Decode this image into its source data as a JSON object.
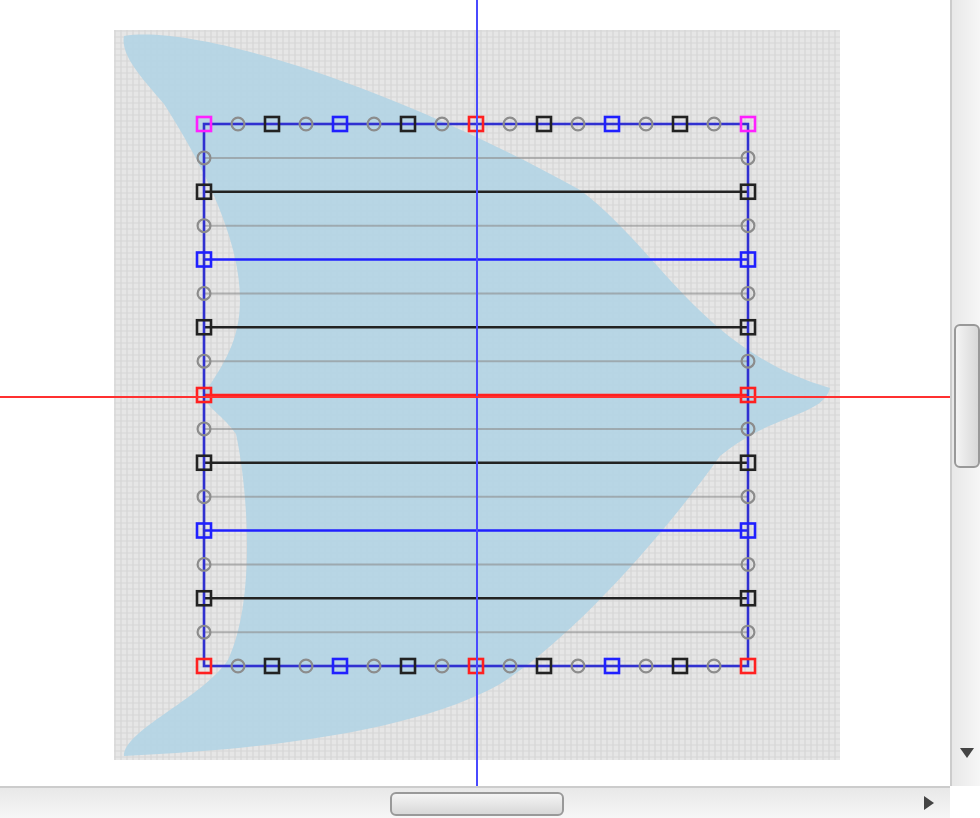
{
  "guides": [
    {
      "kind": "vertical",
      "color": "#4a4aff"
    },
    {
      "kind": "horizontal",
      "color": "#ff3030"
    }
  ],
  "rows": [
    {
      "kind": "circle",
      "color": "#8c8c8c"
    },
    {
      "kind": "square",
      "color": "#222222"
    },
    {
      "kind": "circle",
      "color": "#8c8c8c"
    },
    {
      "kind": "square",
      "color": "#2020ff"
    },
    {
      "kind": "circle",
      "color": "#8c8c8c"
    },
    {
      "kind": "square",
      "color": "#222222"
    },
    {
      "kind": "circle",
      "color": "#8c8c8c"
    },
    {
      "kind": "square",
      "color": "#ff2020"
    },
    {
      "kind": "circle",
      "color": "#8c8c8c"
    },
    {
      "kind": "square",
      "color": "#222222"
    },
    {
      "kind": "circle",
      "color": "#8c8c8c"
    },
    {
      "kind": "square",
      "color": "#2020ff"
    },
    {
      "kind": "circle",
      "color": "#8c8c8c"
    },
    {
      "kind": "square",
      "color": "#222222"
    },
    {
      "kind": "circle",
      "color": "#8c8c8c"
    }
  ],
  "top_handles": [
    {
      "kind": "square",
      "color": "#ff20ff"
    },
    {
      "kind": "circle",
      "color": "#8c8c8c"
    },
    {
      "kind": "square",
      "color": "#222222"
    },
    {
      "kind": "circle",
      "color": "#8c8c8c"
    },
    {
      "kind": "square",
      "color": "#2020ff"
    },
    {
      "kind": "circle",
      "color": "#8c8c8c"
    },
    {
      "kind": "square",
      "color": "#222222"
    },
    {
      "kind": "circle",
      "color": "#8c8c8c"
    },
    {
      "kind": "square",
      "color": "#ff2020"
    },
    {
      "kind": "circle",
      "color": "#8c8c8c"
    },
    {
      "kind": "square",
      "color": "#222222"
    },
    {
      "kind": "circle",
      "color": "#8c8c8c"
    },
    {
      "kind": "square",
      "color": "#2020ff"
    },
    {
      "kind": "circle",
      "color": "#8c8c8c"
    },
    {
      "kind": "square",
      "color": "#222222"
    },
    {
      "kind": "circle",
      "color": "#8c8c8c"
    },
    {
      "kind": "square",
      "color": "#ff20ff"
    }
  ],
  "bottom_handles": [
    {
      "kind": "square",
      "color": "#ff2020"
    },
    {
      "kind": "circle",
      "color": "#8c8c8c"
    },
    {
      "kind": "square",
      "color": "#222222"
    },
    {
      "kind": "circle",
      "color": "#8c8c8c"
    },
    {
      "kind": "square",
      "color": "#2020ff"
    },
    {
      "kind": "circle",
      "color": "#8c8c8c"
    },
    {
      "kind": "square",
      "color": "#222222"
    },
    {
      "kind": "circle",
      "color": "#8c8c8c"
    },
    {
      "kind": "square",
      "color": "#ff2020"
    },
    {
      "kind": "circle",
      "color": "#8c8c8c"
    },
    {
      "kind": "square",
      "color": "#222222"
    },
    {
      "kind": "circle",
      "color": "#8c8c8c"
    },
    {
      "kind": "square",
      "color": "#2020ff"
    },
    {
      "kind": "circle",
      "color": "#8c8c8c"
    },
    {
      "kind": "square",
      "color": "#222222"
    },
    {
      "kind": "circle",
      "color": "#8c8c8c"
    },
    {
      "kind": "square",
      "color": "#ff2020"
    }
  ]
}
